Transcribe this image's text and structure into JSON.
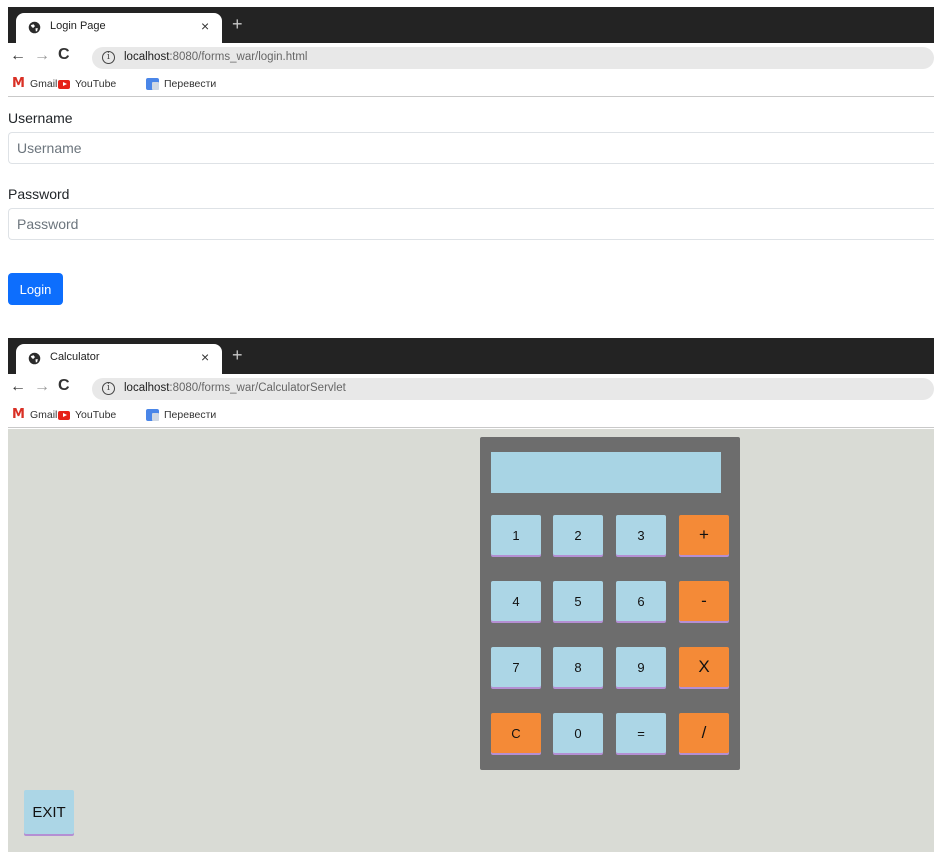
{
  "login_window": {
    "tab_title": "Login Page",
    "tab_close": "×",
    "new_tab": "+",
    "url_host": "localhost",
    "url_rest": ":8080/forms_war/login.html",
    "bookmarks": [
      "Gmail",
      "YouTube",
      "Перевести"
    ],
    "form": {
      "username_label": "Username",
      "username_placeholder": "Username",
      "password_label": "Password",
      "password_placeholder": "Password",
      "login_button": "Login"
    },
    "colors": {
      "primary": "#0d6efd"
    }
  },
  "calculator_window": {
    "tab_title": "Calculator",
    "tab_close": "×",
    "new_tab": "+",
    "url_host": "localhost",
    "url_rest": ":8080/forms_war/CalculatorServlet",
    "bookmarks": [
      "Gmail",
      "YouTube",
      "Перевести"
    ],
    "display_value": "",
    "keys": {
      "k1": "1",
      "k2": "2",
      "k3": "3",
      "plus": "+",
      "k4": "4",
      "k5": "5",
      "k6": "6",
      "minus": "-",
      "k7": "7",
      "k8": "8",
      "k9": "9",
      "multiply": "X",
      "clear": "C",
      "k0": "0",
      "equals": "=",
      "divide": "/"
    },
    "exit_button": "EXIT",
    "colors": {
      "background": "#d9dbd5",
      "body": "#6d6d6d",
      "number_key": "#acd6e6",
      "operator_key": "#f48a37"
    }
  },
  "nav": {
    "back": "←",
    "forward": "→",
    "reload": "C",
    "info": "i"
  }
}
